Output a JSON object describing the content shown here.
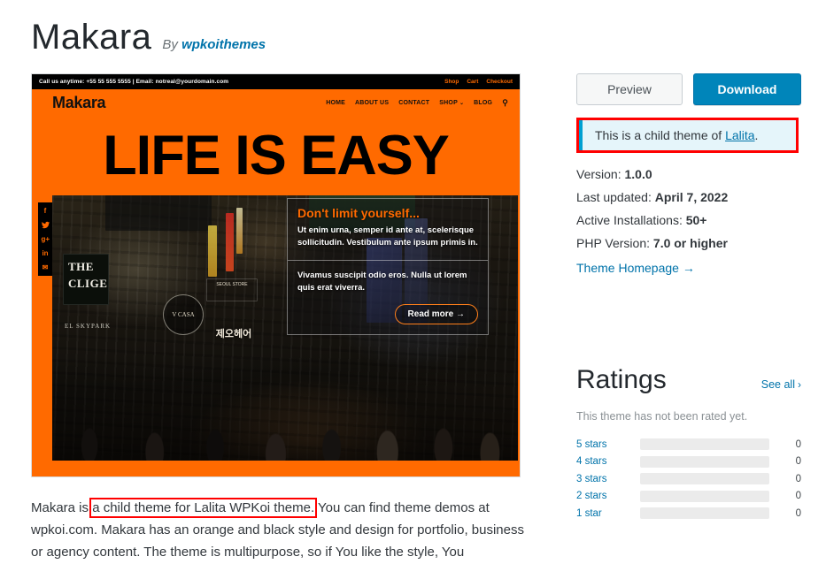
{
  "header": {
    "theme_name": "Makara",
    "by_label": "By",
    "author": "wpkoithemes"
  },
  "screenshot": {
    "topbar": {
      "contact": "Call us anytime: +55 55 555 5555 |   Email: notreal@yourdomain.com",
      "links": [
        "Shop",
        "Cart",
        "Checkout"
      ]
    },
    "nav": {
      "logo": "Makara",
      "items": [
        "HOME",
        "ABOUT US",
        "CONTACT",
        "SHOP"
      ],
      "shop_caret": "⌄",
      "blog": "BLOG",
      "search_icon": "⚲"
    },
    "hero_headline": "LIFE IS EASY",
    "social_icons": [
      "facebook-icon",
      "twitter-icon",
      "google-plus-icon",
      "linkedin-icon",
      "email-icon"
    ],
    "social_glyphs": [
      "f",
      "✉",
      "g+",
      "in",
      "✉"
    ],
    "promo": {
      "heading": "Don't limit yourself...",
      "paragraph": "Ut enim urna, semper id ante at, scelerisque sollicitudin. Vestibulum ante ipsum primis in.",
      "paragraph2": "Vivamus suscipit odio eros. Nulla ut lorem quis erat viverra.",
      "button": "Read more  →"
    },
    "photo_signs": {
      "clige": "THE CLIGE",
      "korean": "제오헤어",
      "skypark": "EL SKYPARK",
      "store": "SEOUL STORE",
      "vcasa": "V CASA"
    }
  },
  "description": {
    "before": "Makara is ",
    "highlight": "a child theme for Lalita WPKoi theme.",
    "after": " You can find theme demos at wpkoi.com. Makara has an orange and black style and design for portfolio, business or agency content. The theme is multipurpose, so if You like the style, You"
  },
  "sidebar": {
    "preview_label": "Preview",
    "download_label": "Download",
    "notice": {
      "text_before": "This is a child theme of ",
      "parent_theme": "Lalita",
      "text_after": "."
    },
    "meta": [
      {
        "label": "Version:",
        "value": "1.0.0"
      },
      {
        "label": "Last updated:",
        "value": "April 7, 2022"
      },
      {
        "label": "Active Installations:",
        "value": "50+"
      },
      {
        "label": "PHP Version:",
        "value": "7.0 or higher"
      }
    ],
    "homepage_link": "Theme Homepage  →"
  },
  "ratings": {
    "title": "Ratings",
    "see_all": "See all",
    "see_all_chevron": "›",
    "empty_message": "This theme has not been rated yet.",
    "rows": [
      {
        "label": "5 stars",
        "count": "0",
        "percent": 0
      },
      {
        "label": "4 stars",
        "count": "0",
        "percent": 0
      },
      {
        "label": "3 stars",
        "count": "0",
        "percent": 0
      },
      {
        "label": "2 stars",
        "count": "0",
        "percent": 0
      },
      {
        "label": "1 star",
        "count": "0",
        "percent": 0
      }
    ]
  },
  "colors": {
    "accent_blue": "#0073aa",
    "download_bg": "#0085ba",
    "theme_orange": "#ff6a00",
    "highlight_red": "#ff0000",
    "notice_bg": "#e5f5fa",
    "notice_border": "#00a0d2"
  }
}
